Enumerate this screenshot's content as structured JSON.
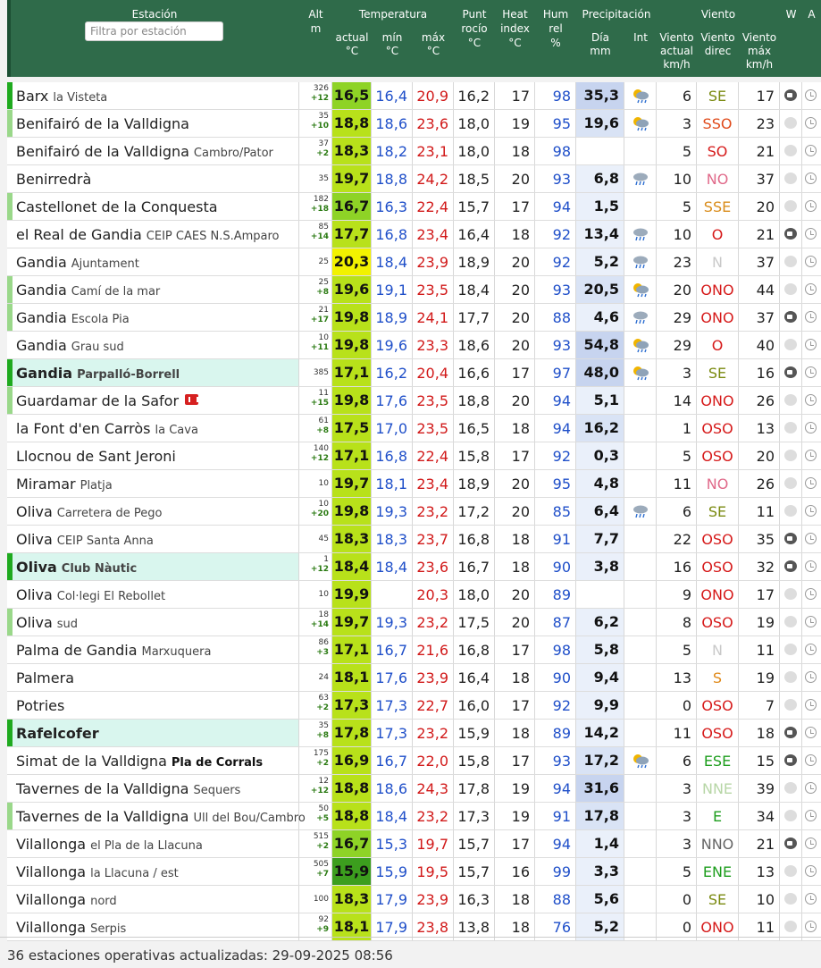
{
  "header": {
    "station": "Estación",
    "filter_placeholder": "Filtra por estación",
    "alt": "Alt",
    "alt_unit": "m",
    "temperatura": "Temperatura",
    "actual": "actual",
    "min": "mín",
    "max": "máx",
    "c_unit": "°C",
    "dew1": "Punt",
    "dew2": "rocío",
    "hi1": "Heat",
    "hi2": "index",
    "hum1": "Hum",
    "hum2": "rel",
    "hum_unit": "%",
    "precipitacion": "Precipitación",
    "dia": "Día",
    "mm": "mm",
    "int": "Int",
    "viento": "Viento",
    "wact1": "Viento",
    "wact2": "actual",
    "wact3": "km/h",
    "wdir1": "Viento",
    "wdir2": "direc",
    "wmax1": "Viento",
    "wmax2": "máx",
    "wmax3": "km/h",
    "w": "W",
    "a": "A"
  },
  "colors": {
    "header_bg": "#2f6b4a",
    "temp_yellow": "#f2f200",
    "temp_lime": "#b8e11a",
    "temp_green": "#6cc62a",
    "temp_dark_green": "#3c9e1e"
  },
  "rows": [
    {
      "name": "Barx",
      "sub": "la Visteta",
      "alt": "326",
      "d": "+12",
      "act": "16,5",
      "min": "16,4",
      "max": "20,9",
      "dew": "16,2",
      "hi": "17",
      "hum": "98",
      "day": "35,3",
      "int": "sun-rain-icon",
      "wact": "6",
      "wdir": "SE",
      "wmax": "17",
      "cam": true,
      "bar": "#1faa1f"
    },
    {
      "name": "Benifairó de la Valldigna",
      "sub": "",
      "alt": "35",
      "d": "+10",
      "act": "18,8",
      "min": "18,6",
      "max": "23,6",
      "dew": "18,0",
      "hi": "19",
      "hum": "95",
      "day": "19,6",
      "int": "sun-rain-icon",
      "wact": "3",
      "wdir": "SSO",
      "wmax": "23",
      "cam": false,
      "bar": "#9ad88a"
    },
    {
      "name": "Benifairó de la Valldigna",
      "sub": "Cambro/Pator",
      "alt": "37",
      "d": "+2",
      "act": "18,3",
      "min": "18,2",
      "max": "23,1",
      "dew": "18,0",
      "hi": "18",
      "hum": "98",
      "day": "",
      "int": "",
      "wact": "5",
      "wdir": "SO",
      "wmax": "21",
      "cam": false,
      "bar": ""
    },
    {
      "name": "Benirredrà",
      "sub": "",
      "alt": "35",
      "d": "",
      "act": "19,7",
      "min": "18,8",
      "max": "24,2",
      "dew": "18,5",
      "hi": "20",
      "hum": "93",
      "day": "6,8",
      "int": "rain-icon",
      "wact": "10",
      "wdir": "NO",
      "wmax": "37",
      "cam": false,
      "bar": ""
    },
    {
      "name": "Castellonet de la Conquesta",
      "sub": "",
      "alt": "182",
      "d": "+18",
      "act": "16,7",
      "min": "16,3",
      "max": "22,4",
      "dew": "15,7",
      "hi": "17",
      "hum": "94",
      "day": "1,5",
      "int": "",
      "wact": "5",
      "wdir": "SSE",
      "wmax": "20",
      "cam": false,
      "bar": "#9ad88a"
    },
    {
      "name": "el Real de Gandia",
      "sub": "CEIP CAES N.S.Amparo",
      "alt": "85",
      "d": "+14",
      "act": "17,7",
      "min": "16,8",
      "max": "23,4",
      "dew": "16,4",
      "hi": "18",
      "hum": "92",
      "day": "13,4",
      "int": "rain-icon",
      "wact": "10",
      "wdir": "O",
      "wmax": "21",
      "cam": true,
      "bar": ""
    },
    {
      "name": "Gandia",
      "sub": "Ajuntament",
      "alt": "25",
      "d": "",
      "act": "20,3",
      "min": "18,4",
      "max": "23,9",
      "dew": "18,9",
      "hi": "20",
      "hum": "92",
      "day": "5,2",
      "int": "rain-icon",
      "wact": "23",
      "wdir": "N",
      "wmax": "37",
      "cam": false,
      "bar": ""
    },
    {
      "name": "Gandia",
      "sub": "Camí de la mar",
      "alt": "25",
      "d": "+8",
      "act": "19,6",
      "min": "19,1",
      "max": "23,5",
      "dew": "18,4",
      "hi": "20",
      "hum": "93",
      "day": "20,5",
      "int": "sun-rain-icon",
      "wact": "20",
      "wdir": "ONO",
      "wmax": "44",
      "cam": false,
      "bar": "#9ad88a"
    },
    {
      "name": "Gandia",
      "sub": "Escola Pia",
      "alt": "21",
      "d": "+17",
      "act": "19,8",
      "min": "18,9",
      "max": "24,1",
      "dew": "17,7",
      "hi": "20",
      "hum": "88",
      "day": "4,6",
      "int": "rain-icon",
      "wact": "29",
      "wdir": "ONO",
      "wmax": "37",
      "cam": true,
      "bar": "#9ad88a"
    },
    {
      "name": "Gandia",
      "sub": "Grau sud",
      "alt": "10",
      "d": "+11",
      "act": "19,8",
      "min": "19,6",
      "max": "23,3",
      "dew": "18,6",
      "hi": "20",
      "hum": "93",
      "day": "54,8",
      "int": "sun-rain-icon",
      "wact": "29",
      "wdir": "O",
      "wmax": "40",
      "cam": false,
      "bar": ""
    },
    {
      "name": "Gandia",
      "sub": "Parpalló-Borrell",
      "alt": "385",
      "d": "",
      "act": "17,1",
      "min": "16,2",
      "max": "20,4",
      "dew": "16,6",
      "hi": "17",
      "hum": "97",
      "day": "48,0",
      "int": "sun-rain-icon",
      "wact": "3",
      "wdir": "SE",
      "wmax": "16",
      "cam": true,
      "bar": "#1faa1f",
      "hl": true,
      "bold": true
    },
    {
      "name": "Guardamar de la Safor",
      "sub": "",
      "alt": "11",
      "d": "+15",
      "act": "19,8",
      "min": "17,6",
      "max": "23,5",
      "dew": "18,8",
      "hi": "20",
      "hum": "94",
      "day": "5,1",
      "int": "",
      "wact": "14",
      "wdir": "ONO",
      "wmax": "26",
      "cam": false,
      "bar": "#9ad88a",
      "badge": true
    },
    {
      "name": "la Font d'en Carròs",
      "sub": "la Cava",
      "alt": "61",
      "d": "+8",
      "act": "17,5",
      "min": "17,0",
      "max": "23,5",
      "dew": "16,5",
      "hi": "18",
      "hum": "94",
      "day": "16,2",
      "int": "",
      "wact": "1",
      "wdir": "OSO",
      "wmax": "13",
      "cam": false,
      "bar": ""
    },
    {
      "name": "Llocnou de Sant Jeroni",
      "sub": "",
      "alt": "140",
      "d": "+12",
      "act": "17,1",
      "min": "16,8",
      "max": "22,4",
      "dew": "15,8",
      "hi": "17",
      "hum": "92",
      "day": "0,3",
      "int": "",
      "wact": "5",
      "wdir": "OSO",
      "wmax": "20",
      "cam": false,
      "bar": ""
    },
    {
      "name": "Miramar",
      "sub": "Platja",
      "alt": "10",
      "d": "",
      "act": "19,7",
      "min": "18,1",
      "max": "23,4",
      "dew": "18,9",
      "hi": "20",
      "hum": "95",
      "day": "4,8",
      "int": "",
      "wact": "11",
      "wdir": "NO",
      "wmax": "26",
      "cam": false,
      "bar": ""
    },
    {
      "name": "Oliva",
      "sub": "Carretera de Pego",
      "alt": "10",
      "d": "+20",
      "act": "19,8",
      "min": "19,3",
      "max": "23,2",
      "dew": "17,2",
      "hi": "20",
      "hum": "85",
      "day": "6,4",
      "int": "rain-icon",
      "wact": "6",
      "wdir": "SE",
      "wmax": "11",
      "cam": false,
      "bar": ""
    },
    {
      "name": "Oliva",
      "sub": "CEIP Santa Anna",
      "alt": "45",
      "d": "",
      "act": "18,3",
      "min": "18,3",
      "max": "23,7",
      "dew": "16,8",
      "hi": "18",
      "hum": "91",
      "day": "7,7",
      "int": "",
      "wact": "22",
      "wdir": "OSO",
      "wmax": "35",
      "cam": true,
      "bar": ""
    },
    {
      "name": "Oliva",
      "sub": "Club Nàutic",
      "alt": "1",
      "d": "+12",
      "act": "18,4",
      "min": "18,4",
      "max": "23,6",
      "dew": "16,7",
      "hi": "18",
      "hum": "90",
      "day": "3,8",
      "int": "",
      "wact": "16",
      "wdir": "OSO",
      "wmax": "32",
      "cam": true,
      "bar": "#1faa1f",
      "hl": true,
      "bold": true
    },
    {
      "name": "Oliva",
      "sub": "Col·legi El Rebollet",
      "alt": "10",
      "d": "",
      "act": "19,9",
      "min": "",
      "max": "20,3",
      "dew": "18,0",
      "hi": "20",
      "hum": "89",
      "day": "",
      "int": "",
      "wact": "9",
      "wdir": "ONO",
      "wmax": "17",
      "cam": false,
      "bar": ""
    },
    {
      "name": "Oliva",
      "sub": "sud",
      "alt": "18",
      "d": "+14",
      "act": "19,7",
      "min": "19,3",
      "max": "23,2",
      "dew": "17,5",
      "hi": "20",
      "hum": "87",
      "day": "6,2",
      "int": "",
      "wact": "8",
      "wdir": "OSO",
      "wmax": "19",
      "cam": false,
      "bar": "#9ad88a"
    },
    {
      "name": "Palma de Gandia",
      "sub": "Marxuquera",
      "alt": "86",
      "d": "+3",
      "act": "17,1",
      "min": "16,7",
      "max": "21,6",
      "dew": "16,8",
      "hi": "17",
      "hum": "98",
      "day": "5,8",
      "int": "",
      "wact": "5",
      "wdir": "N",
      "wmax": "11",
      "cam": false,
      "bar": ""
    },
    {
      "name": "Palmera",
      "sub": "",
      "alt": "24",
      "d": "",
      "act": "18,1",
      "min": "17,6",
      "max": "23,9",
      "dew": "16,4",
      "hi": "18",
      "hum": "90",
      "day": "9,4",
      "int": "",
      "wact": "13",
      "wdir": "S",
      "wmax": "19",
      "cam": false,
      "bar": ""
    },
    {
      "name": "Potries",
      "sub": "",
      "alt": "63",
      "d": "+2",
      "act": "17,3",
      "min": "17,3",
      "max": "22,7",
      "dew": "16,0",
      "hi": "17",
      "hum": "92",
      "day": "9,9",
      "int": "",
      "wact": "0",
      "wdir": "OSO",
      "wmax": "7",
      "cam": false,
      "bar": ""
    },
    {
      "name": "Rafelcofer",
      "sub": "",
      "alt": "35",
      "d": "+8",
      "act": "17,8",
      "min": "17,3",
      "max": "23,2",
      "dew": "15,9",
      "hi": "18",
      "hum": "89",
      "day": "14,2",
      "int": "",
      "wact": "11",
      "wdir": "OSO",
      "wmax": "18",
      "cam": true,
      "bar": "#1faa1f",
      "hl": true,
      "bold": true
    },
    {
      "name": "Simat de la Valldigna",
      "sub": "Pla de Corrals",
      "subbold": true,
      "alt": "175",
      "d": "+2",
      "act": "16,9",
      "min": "16,7",
      "max": "22,0",
      "dew": "15,8",
      "hi": "17",
      "hum": "93",
      "day": "17,2",
      "int": "sun-rain-icon",
      "wact": "6",
      "wdir": "ESE",
      "wmax": "15",
      "cam": true,
      "bar": ""
    },
    {
      "name": "Tavernes de la Valldigna",
      "sub": "Sequers",
      "alt": "12",
      "d": "+12",
      "act": "18,8",
      "min": "18,6",
      "max": "24,3",
      "dew": "17,8",
      "hi": "19",
      "hum": "94",
      "day": "31,6",
      "int": "",
      "wact": "3",
      "wdir": "NNE",
      "wmax": "39",
      "cam": false,
      "bar": ""
    },
    {
      "name": "Tavernes de la Valldigna",
      "sub": "Ull del Bou/Cambro",
      "alt": "50",
      "d": "+5",
      "act": "18,8",
      "min": "18,4",
      "max": "23,2",
      "dew": "17,3",
      "hi": "19",
      "hum": "91",
      "day": "17,8",
      "int": "",
      "wact": "3",
      "wdir": "E",
      "wmax": "34",
      "cam": false,
      "bar": "#9ad88a"
    },
    {
      "name": "Vilallonga",
      "sub": "el Pla de la Llacuna",
      "alt": "515",
      "d": "+2",
      "act": "16,7",
      "min": "15,3",
      "max": "19,7",
      "dew": "15,7",
      "hi": "17",
      "hum": "94",
      "day": "1,4",
      "int": "",
      "wact": "3",
      "wdir": "NNO",
      "wmax": "21",
      "cam": true,
      "bar": ""
    },
    {
      "name": "Vilallonga",
      "sub": "la Llacuna / est",
      "alt": "505",
      "d": "+7",
      "act": "15,9",
      "min": "15,9",
      "max": "19,5",
      "dew": "15,7",
      "hi": "16",
      "hum": "99",
      "day": "3,3",
      "int": "",
      "wact": "5",
      "wdir": "ENE",
      "wmax": "13",
      "cam": false,
      "bar": ""
    },
    {
      "name": "Vilallonga",
      "sub": "nord",
      "alt": "100",
      "d": "",
      "act": "18,3",
      "min": "17,9",
      "max": "23,9",
      "dew": "16,3",
      "hi": "18",
      "hum": "88",
      "day": "5,6",
      "int": "",
      "wact": "0",
      "wdir": "SE",
      "wmax": "10",
      "cam": false,
      "bar": ""
    },
    {
      "name": "Vilallonga",
      "sub": "Serpis",
      "alt": "92",
      "d": "+9",
      "act": "18,1",
      "min": "17,9",
      "max": "23,8",
      "dew": "13,8",
      "hi": "18",
      "hum": "76",
      "day": "5,2",
      "int": "",
      "wact": "0",
      "wdir": "ONO",
      "wmax": "11",
      "cam": false,
      "bar": ""
    }
  ],
  "footer": "36 estaciones operativas actualizadas: 29-09-2025 08:56"
}
